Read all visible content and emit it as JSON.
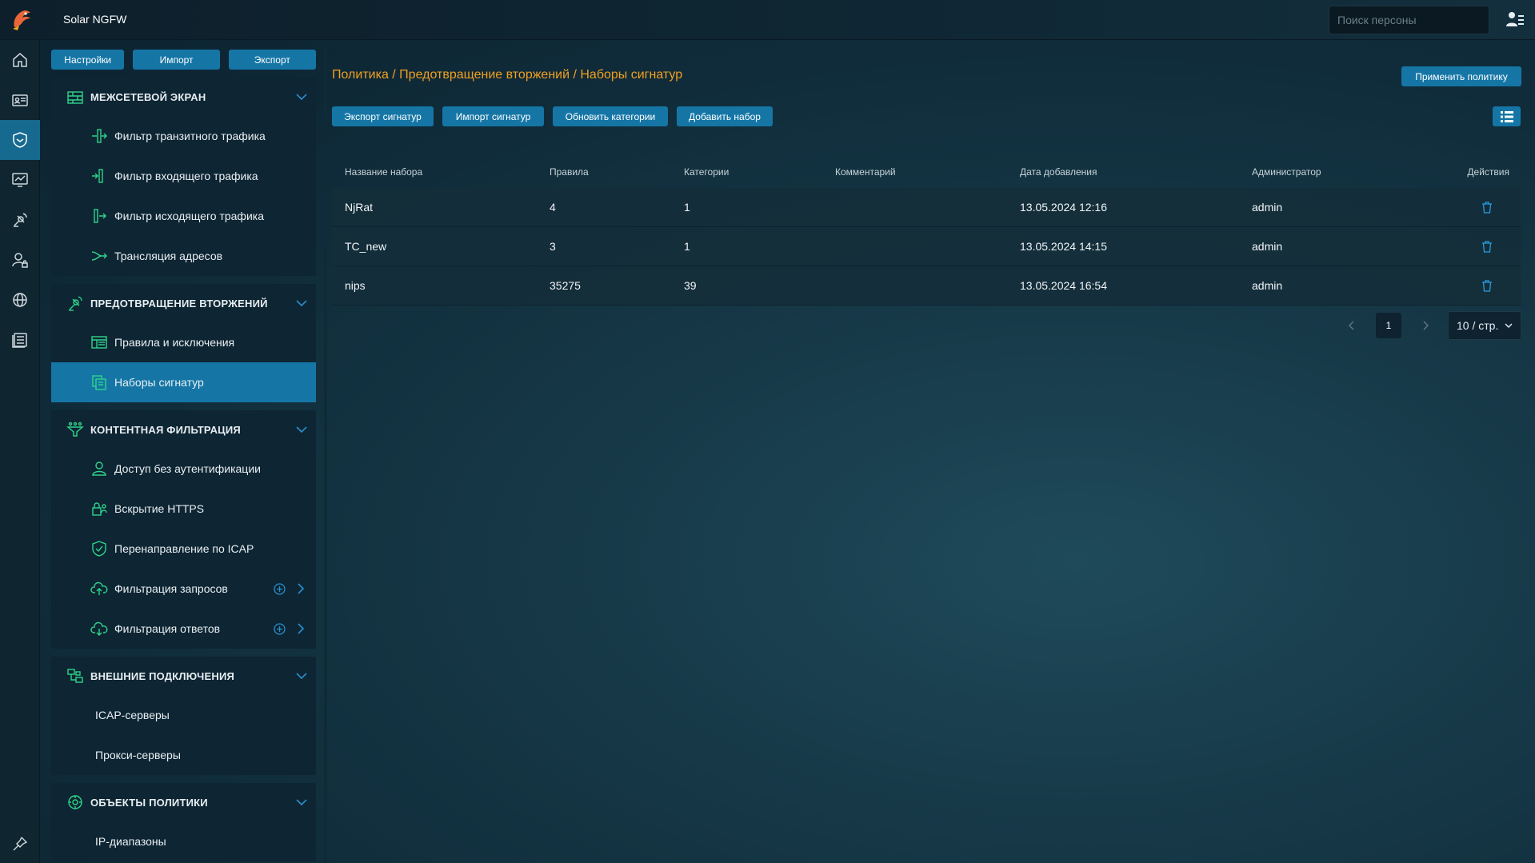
{
  "app": {
    "title": "Solar NGFW"
  },
  "search": {
    "placeholder": "Поиск персоны"
  },
  "sidebar_buttons": [
    "Настройки",
    "Импорт",
    "Экспорт"
  ],
  "sections": [
    {
      "title": "МЕЖСЕТЕВОЙ ЭКРАН",
      "items": [
        "Фильтр транзитного трафика",
        "Фильтр входящего трафика",
        "Фильтр исходящего трафика",
        "Трансляция адресов"
      ]
    },
    {
      "title": "ПРЕДОТВРАЩЕНИЕ ВТОРЖЕНИЙ",
      "items": [
        "Правила и исключения",
        "Наборы сигнатур"
      ]
    },
    {
      "title": "КОНТЕНТНАЯ ФИЛЬТРАЦИЯ",
      "items": [
        "Доступ без аутентификации",
        "Вскрытие HTTPS",
        "Перенаправление по ICAP",
        "Фильтрация запросов",
        "Фильтрация ответов"
      ]
    },
    {
      "title": "ВНЕШНИЕ ПОДКЛЮЧЕНИЯ",
      "items": [
        "ICAP-серверы",
        "Прокси-серверы"
      ]
    },
    {
      "title": "ОБЪЕКТЫ ПОЛИТИКИ",
      "items": [
        "IP-диапазоны"
      ]
    }
  ],
  "breadcrumb": "Политика / Предотвращение вторжений / Наборы сигнатур",
  "apply_button": "Применить политику",
  "toolbar": [
    "Экспорт сигнатур",
    "Импорт сигнатур",
    "Обновить категории",
    "Добавить набор"
  ],
  "table": {
    "headers": [
      "Название набора",
      "Правила",
      "Категории",
      "Комментарий",
      "Дата добавления",
      "Администратор",
      "Действия"
    ],
    "rows": [
      [
        "NjRat",
        "4",
        "1",
        "",
        "13.05.2024 12:16",
        "admin"
      ],
      [
        "TC_new",
        "3",
        "1",
        "",
        "13.05.2024 14:15",
        "admin"
      ],
      [
        "nips",
        "35275",
        "39",
        "",
        "13.05.2024 16:54",
        "admin"
      ]
    ]
  },
  "pagination": {
    "current_page": "1",
    "page_size": "10 / стр."
  },
  "colors": {
    "accent": "#1576a6",
    "breadcrumb": "#f0a020",
    "icon_green": "#2fd48a"
  }
}
